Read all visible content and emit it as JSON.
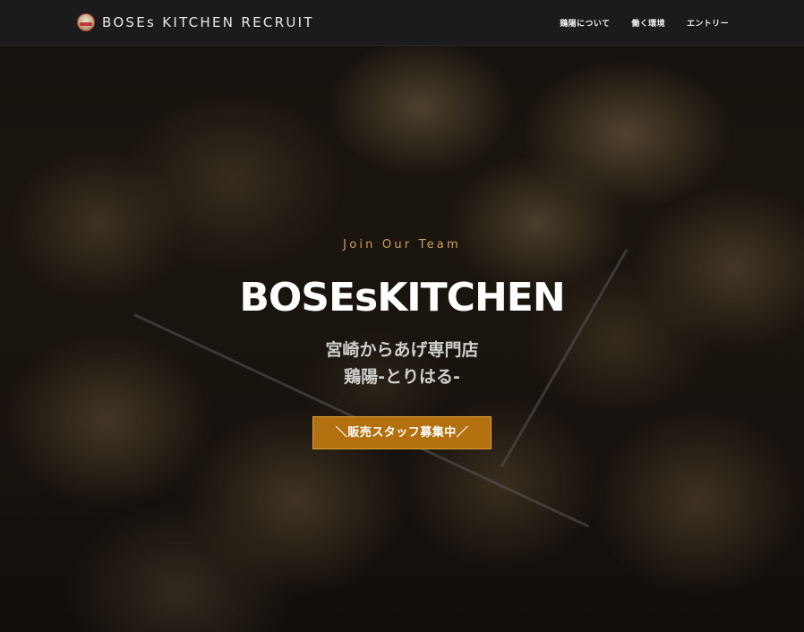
{
  "header": {
    "logo_text": "BOSEs KITCHEN RECRUIT",
    "nav": [
      {
        "label": "鶏陽について"
      },
      {
        "label": "働く環境"
      },
      {
        "label": "エントリー"
      }
    ]
  },
  "hero": {
    "eyebrow": "Join Our Team",
    "title": "BOSEsKITCHEN",
    "subtitle_line1": "宮崎からあげ専門店",
    "subtitle_line2": "鶏陽-とりはる-",
    "cta_label": "＼販売スタッフ募集中／"
  },
  "colors": {
    "header_bg": "#1b1b1b",
    "eyebrow": "#c9a060",
    "cta_bg": "#b3700f",
    "cta_border": "#e0a13a"
  }
}
